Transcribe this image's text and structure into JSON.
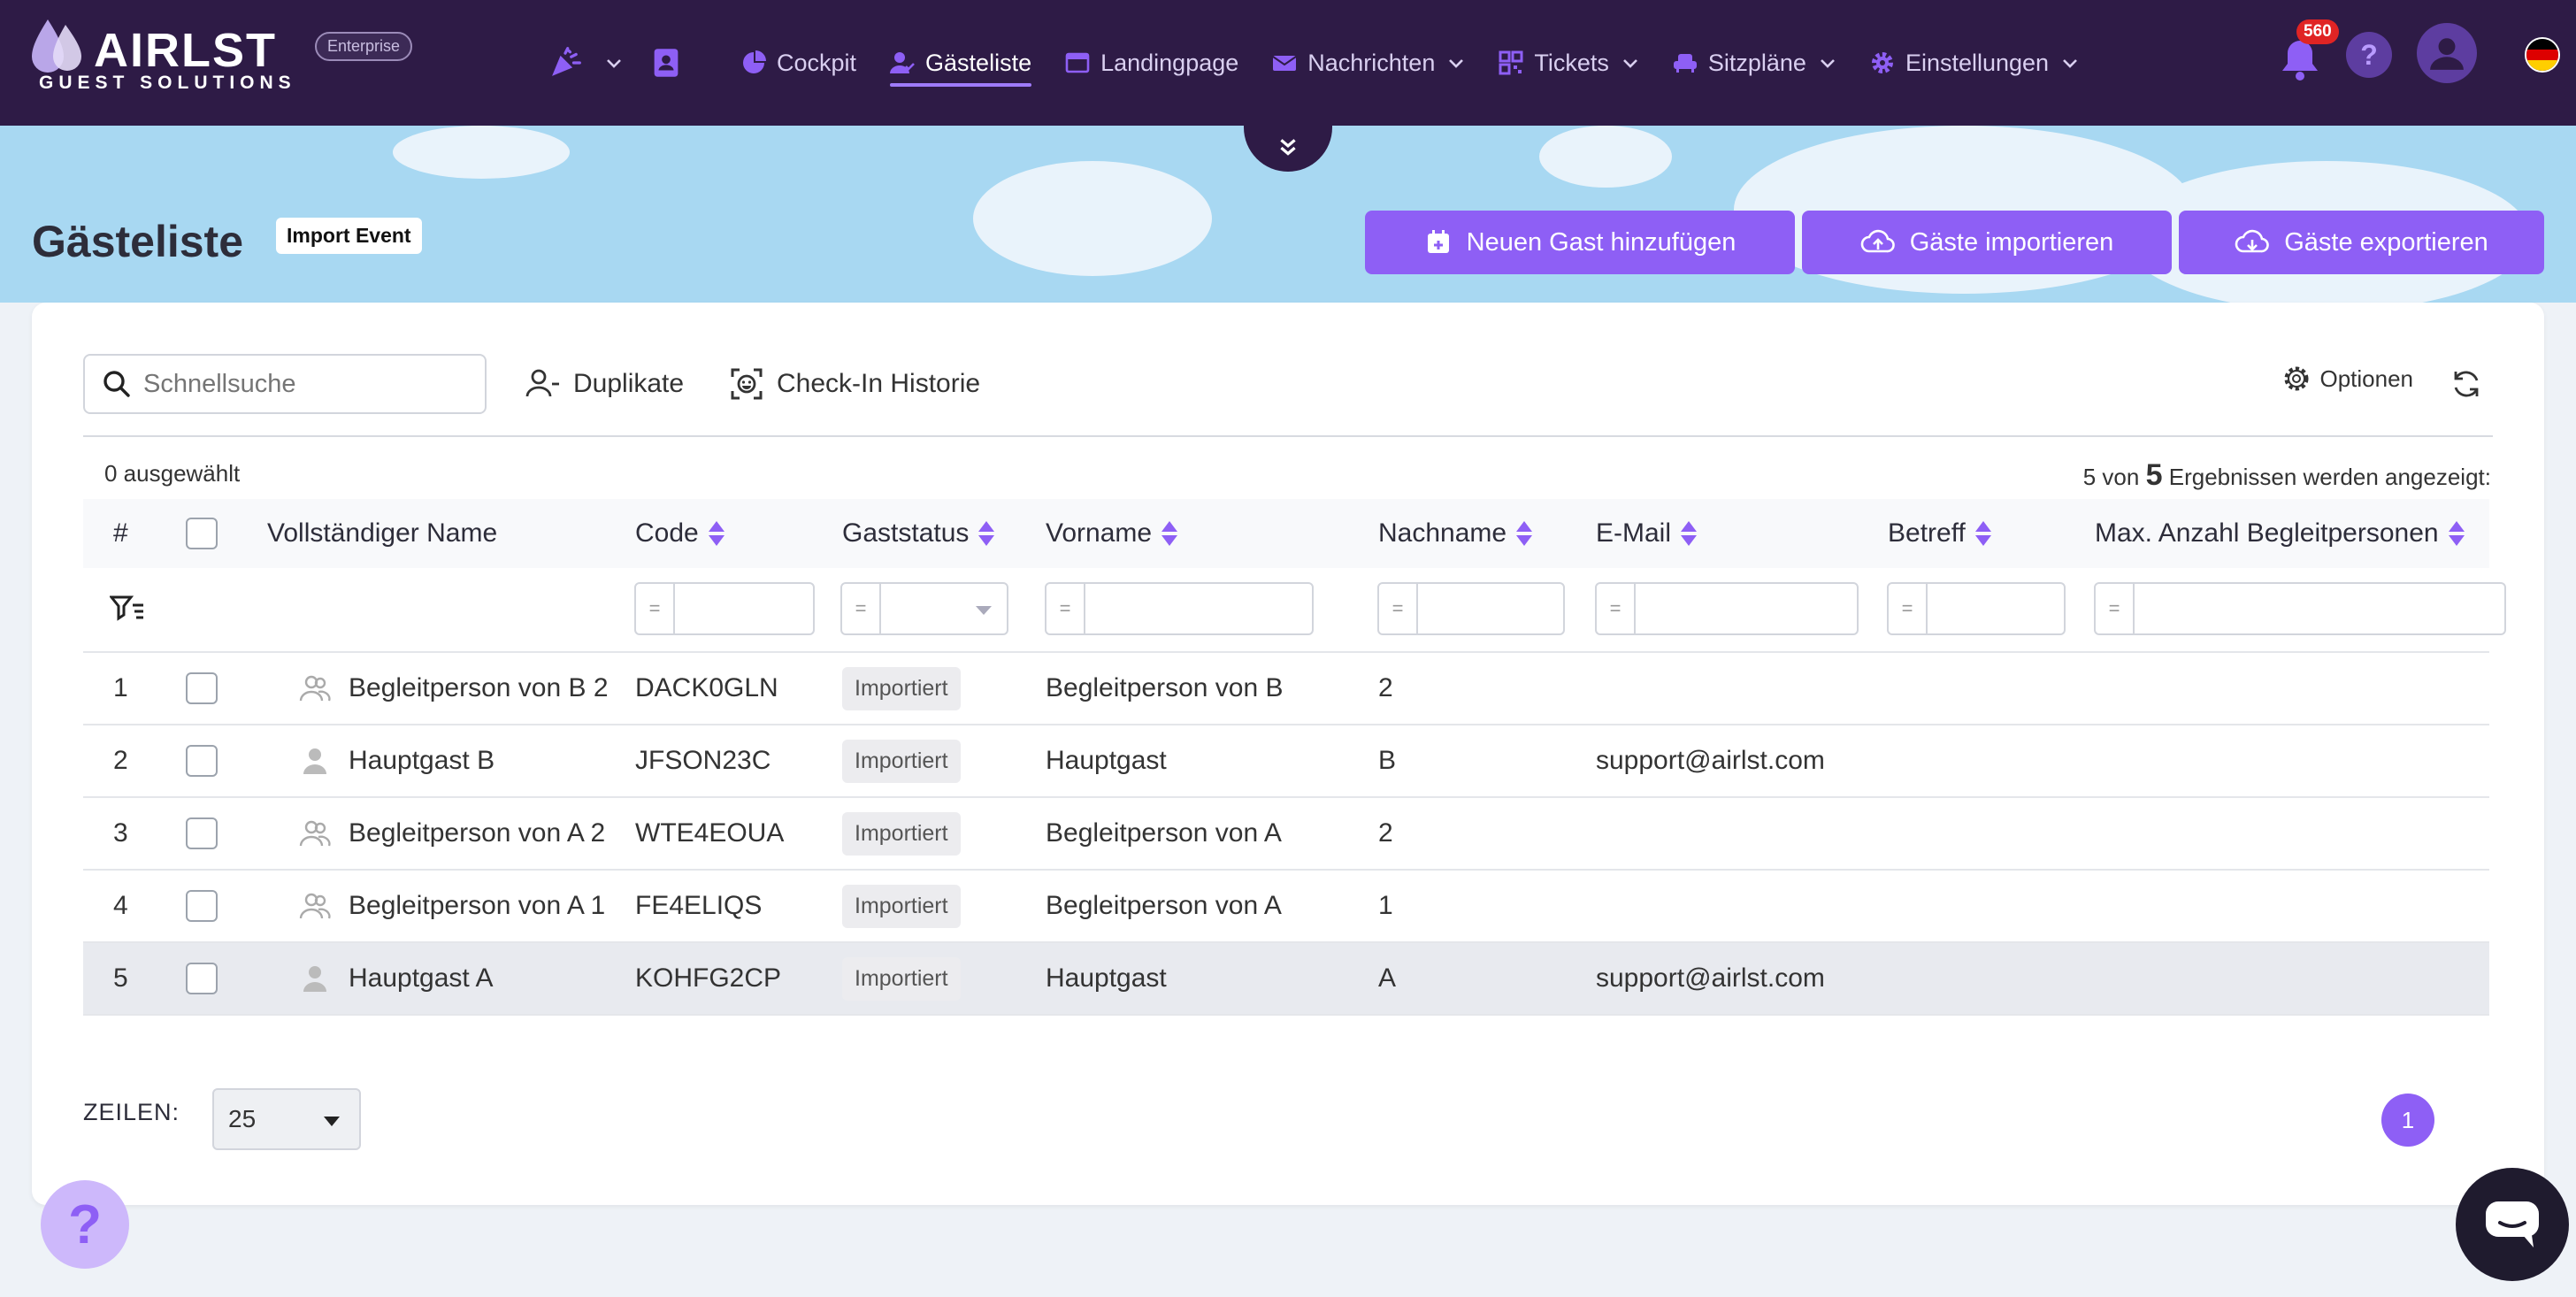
{
  "brand": {
    "name": "AIRLST",
    "tagline": "GUEST SOLUTIONS",
    "plan_badge": "Enterprise"
  },
  "nav": {
    "items": [
      {
        "label": "Cockpit",
        "icon": "pie-chart-icon"
      },
      {
        "label": "Gästeliste",
        "icon": "user-check-icon",
        "active": true
      },
      {
        "label": "Landingpage",
        "icon": "browser-window-icon"
      },
      {
        "label": "Nachrichten",
        "icon": "envelope-icon",
        "dropdown": true
      },
      {
        "label": "Tickets",
        "icon": "qr-code-icon",
        "dropdown": true
      },
      {
        "label": "Sitzpläne",
        "icon": "armchair-icon",
        "dropdown": true
      },
      {
        "label": "Einstellungen",
        "icon": "gear-icon",
        "dropdown": true
      }
    ],
    "notifications_count": "560",
    "help_label": "?",
    "accent_color": "#8e5ff5",
    "navbar_color": "#2e1b46"
  },
  "page": {
    "title": "Gästeliste",
    "event_badge": "Import Event",
    "actions": {
      "add_guest": "Neuen Gast hinzufügen",
      "import_guests": "Gäste importieren",
      "export_guests": "Gäste exportieren"
    }
  },
  "toolbar": {
    "search_placeholder": "Schnellsuche",
    "duplicates": "Duplikate",
    "checkin_history": "Check-In Historie",
    "options": "Optionen"
  },
  "summary": {
    "selected": "0 ausgewählt",
    "results_prefix": "5 von",
    "results_total": "5",
    "results_suffix": "Ergebnissen werden angezeigt:"
  },
  "table": {
    "columns": {
      "index": "#",
      "full_name": "Vollständiger Name",
      "code": "Code",
      "status": "Gaststatus",
      "first_name": "Vorname",
      "last_name": "Nachname",
      "email": "E-Mail",
      "subject": "Betreff",
      "max_companions": "Max. Anzahl Begleitpersonen"
    },
    "filter_operator": "=",
    "rows": [
      {
        "index": "1",
        "full_name": "Begleitperson von B 2",
        "type": "companion",
        "code": "DACK0GLN",
        "status": "Importiert",
        "first_name": "Begleitperson von B",
        "last_name": "2",
        "email": ""
      },
      {
        "index": "2",
        "full_name": "Hauptgast B",
        "type": "main",
        "code": "JFSON23C",
        "status": "Importiert",
        "first_name": "Hauptgast",
        "last_name": "B",
        "email": "support@airlst.com"
      },
      {
        "index": "3",
        "full_name": "Begleitperson von A 2",
        "type": "companion",
        "code": "WTE4EOUA",
        "status": "Importiert",
        "first_name": "Begleitperson von A",
        "last_name": "2",
        "email": ""
      },
      {
        "index": "4",
        "full_name": "Begleitperson von A 1",
        "type": "companion",
        "code": "FE4ELIQS",
        "status": "Importiert",
        "first_name": "Begleitperson von A",
        "last_name": "1",
        "email": ""
      },
      {
        "index": "5",
        "full_name": "Hauptgast A",
        "type": "main",
        "code": "KOHFG2CP",
        "status": "Importiert",
        "first_name": "Hauptgast",
        "last_name": "A",
        "email": "support@airlst.com",
        "highlighted": true
      }
    ]
  },
  "pagination": {
    "rows_label": "ZEILEN:",
    "rows_value": "25",
    "current_page": "1"
  },
  "help_fab": "?"
}
